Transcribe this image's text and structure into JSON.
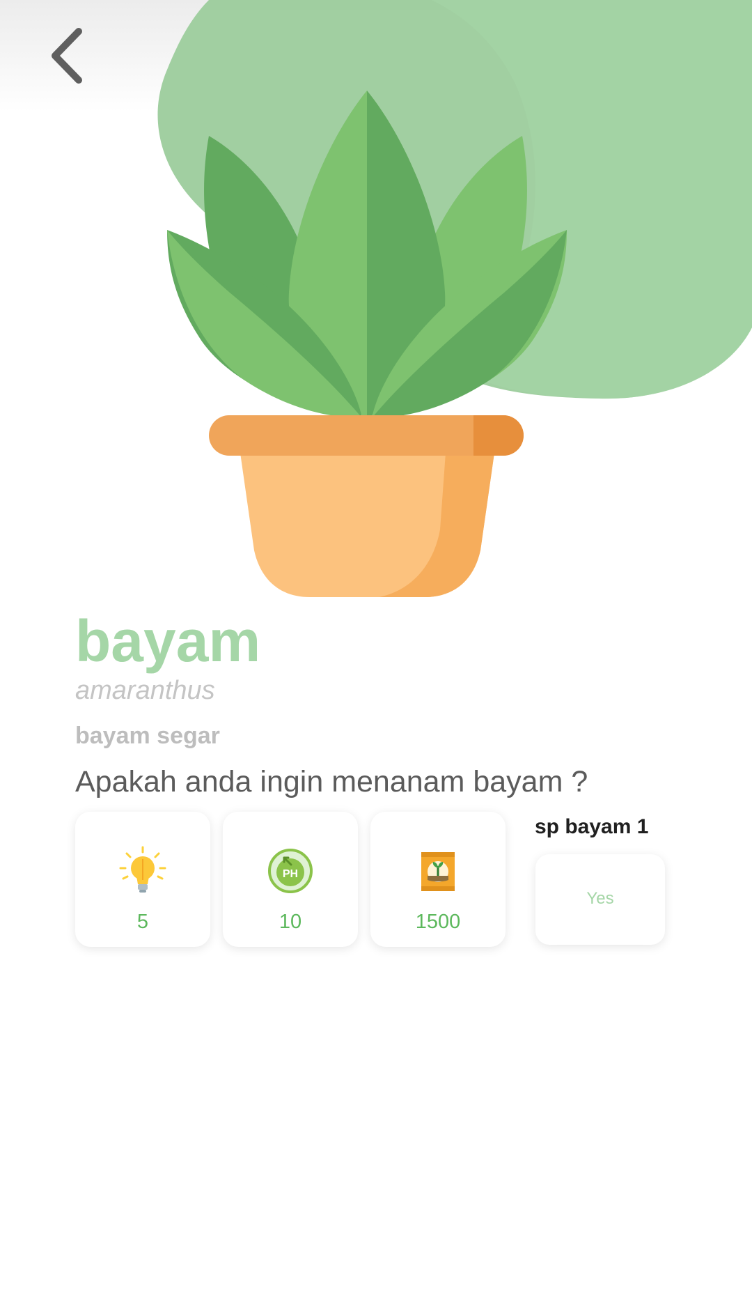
{
  "colors": {
    "accent_green": "#a5d6a7",
    "value_green": "#5cb85c",
    "blob_green": "#9ccc9c",
    "leaf_light": "#7ec26f",
    "leaf_dark": "#62aa5f",
    "pot_rim": "#f0a55a",
    "pot_body": "#fcc27e",
    "pot_shade": "#f6ad5c"
  },
  "header": {
    "back_icon": "chevron-left-icon"
  },
  "plant": {
    "name": "bayam",
    "latin_name": "amaranthus",
    "subtitle": "bayam segar",
    "question": "Apakah anda ingin menanam bayam ?"
  },
  "stats": [
    {
      "icon": "lightbulb-icon",
      "value": "5"
    },
    {
      "icon": "ph-meter-icon",
      "value": "10"
    },
    {
      "icon": "seed-bag-icon",
      "value": "1500"
    }
  ],
  "sp": {
    "label": "sp bayam 1",
    "value": "Yes"
  }
}
